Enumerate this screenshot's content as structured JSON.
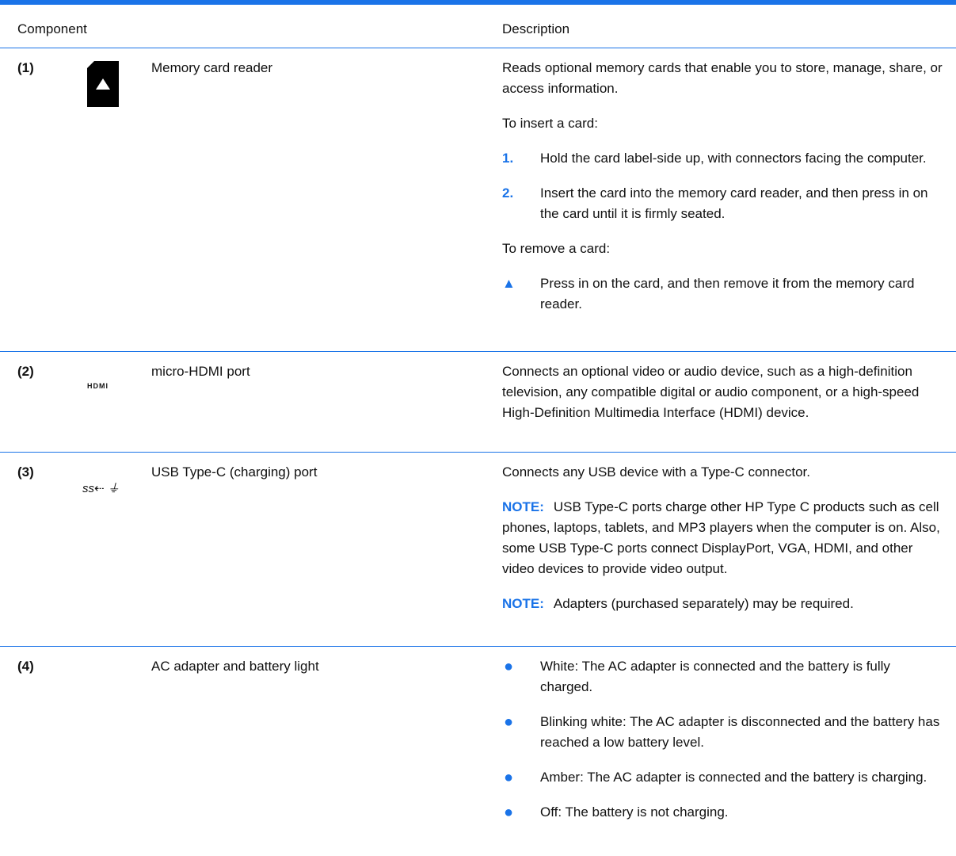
{
  "colors": {
    "accent": "#1a73e8",
    "text": "#111111"
  },
  "header": {
    "component": "Component",
    "description": "Description"
  },
  "rows": [
    {
      "num": "(1)",
      "icon": "memory-card-icon",
      "component": "Memory card reader",
      "desc_intro": "Reads optional memory cards that enable you to store, manage, share, or access information.",
      "insert_title": "To insert a card:",
      "steps": [
        {
          "marker": "1.",
          "text": "Hold the card label-side up, with connectors facing the computer."
        },
        {
          "marker": "2.",
          "text": "Insert the card into the memory card reader, and then press in on the card until it is firmly seated."
        }
      ],
      "remove_title": "To remove a card:",
      "remove_step": {
        "marker": "▲",
        "text": "Press in on the card, and then remove it from the memory card reader."
      }
    },
    {
      "num": "(2)",
      "icon": "hdmi-icon",
      "icon_text": "HDMI",
      "component": "micro-HDMI port",
      "desc": "Connects an optional video or audio device, such as a high-definition television, any compatible digital or audio component, or a high-speed High-Definition Multimedia Interface (HDMI) device."
    },
    {
      "num": "(3)",
      "icon": "usb-c-charging-icon",
      "icon_text": "ss⇠ ⏚",
      "component": "USB Type-C (charging) port",
      "desc": "Connects any USB device with a Type-C connector.",
      "notes": [
        {
          "label": "NOTE:",
          "text": "USB Type-C ports charge other HP Type C products such as cell phones, laptops, tablets, and MP3 players when the computer is on. Also, some USB Type-C ports connect DisplayPort, VGA, HDMI, and other video devices to provide video output."
        },
        {
          "label": "NOTE:",
          "text": "Adapters (purchased separately) may be required."
        }
      ]
    },
    {
      "num": "(4)",
      "component": "AC adapter and battery light",
      "bullets": [
        {
          "marker": "●",
          "text": "White: The AC adapter is connected and the battery is fully charged."
        },
        {
          "marker": "●",
          "text": "Blinking white: The AC adapter is disconnected and the battery has reached a low battery level."
        },
        {
          "marker": "●",
          "text": "Amber: The AC adapter is connected and the battery is charging."
        },
        {
          "marker": "●",
          "text": "Off: The battery is not charging."
        }
      ]
    }
  ]
}
